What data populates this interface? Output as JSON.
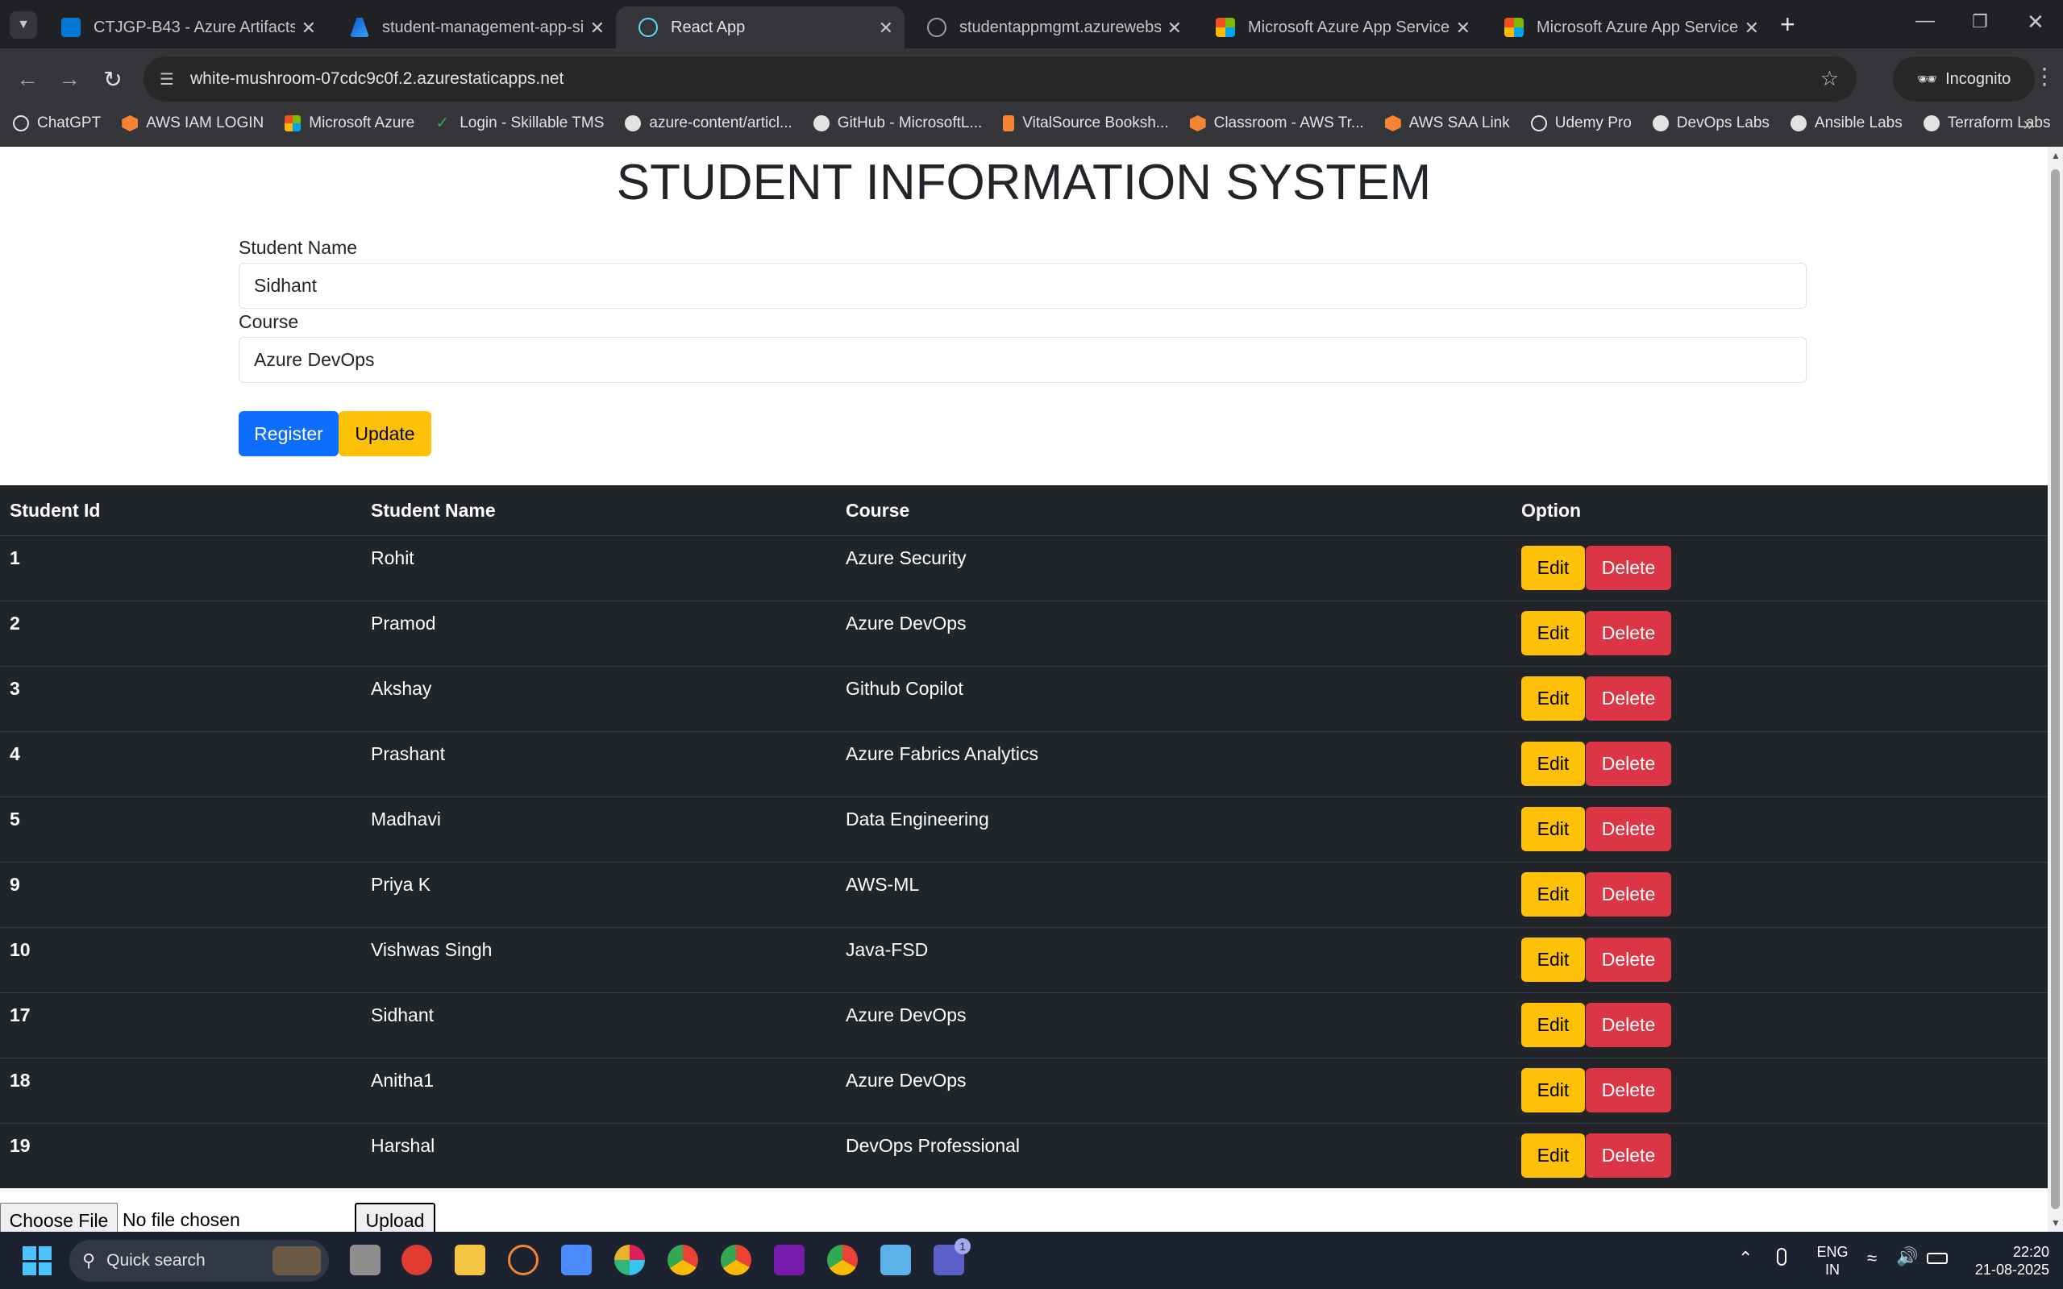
{
  "browser": {
    "tabs": [
      {
        "label": "CTJGP-B43 - Azure Artifacts",
        "favicon": "azure-devops-icon",
        "active": false
      },
      {
        "label": "student-management-app-sidh",
        "favicon": "azure-icon",
        "active": false
      },
      {
        "label": "React App",
        "favicon": "react-icon",
        "active": true
      },
      {
        "label": "studentappmgmt.azurewebsite",
        "favicon": "globe-icon",
        "active": false
      },
      {
        "label": "Microsoft Azure App Service - W",
        "favicon": "microsoft-icon",
        "active": false
      },
      {
        "label": "Microsoft Azure App Service - W",
        "favicon": "microsoft-icon",
        "active": false
      }
    ],
    "url": "white-mushroom-07cdc9c0f.2.azurestaticapps.net",
    "incognito_label": "Incognito",
    "bookmarks": [
      "ChatGPT",
      "AWS IAM LOGIN",
      "Microsoft Azure",
      "Login - Skillable TMS",
      "azure-content/articl...",
      "GitHub - MicrosoftL...",
      "VitalSource Booksh...",
      "Classroom - AWS Tr...",
      "AWS SAA Link",
      "Udemy Pro",
      "DevOps Labs",
      "Ansible Labs",
      "Terraform Labs"
    ]
  },
  "app": {
    "title": "STUDENT INFORMATION SYSTEM",
    "form": {
      "name_label": "Student Name",
      "name_value": "Sidhant",
      "course_label": "Course",
      "course_value": "Azure DevOps",
      "register_label": "Register",
      "update_label": "Update"
    },
    "table": {
      "headers": [
        "Student Id",
        "Student Name",
        "Course",
        "Option"
      ],
      "edit_label": "Edit",
      "delete_label": "Delete",
      "rows": [
        {
          "id": "1",
          "name": "Rohit",
          "course": "Azure Security"
        },
        {
          "id": "2",
          "name": "Pramod",
          "course": "Azure DevOps"
        },
        {
          "id": "3",
          "name": "Akshay",
          "course": "Github Copilot"
        },
        {
          "id": "4",
          "name": "Prashant",
          "course": "Azure Fabrics Analytics"
        },
        {
          "id": "5",
          "name": "Madhavi",
          "course": "Data Engineering"
        },
        {
          "id": "9",
          "name": "Priya K",
          "course": "AWS-ML"
        },
        {
          "id": "10",
          "name": "Vishwas Singh",
          "course": "Java-FSD"
        },
        {
          "id": "17",
          "name": "Sidhant",
          "course": "Azure DevOps"
        },
        {
          "id": "18",
          "name": "Anitha1",
          "course": "Azure DevOps"
        },
        {
          "id": "19",
          "name": "Harshal",
          "course": "DevOps Professional"
        }
      ]
    },
    "file": {
      "choose_label": "Choose File",
      "status": "No file chosen",
      "upload_label": "Upload"
    }
  },
  "taskbar": {
    "search_placeholder": "Quick search",
    "language_line1": "ENG",
    "language_line2": "IN",
    "time": "22:20",
    "date": "21-08-2025",
    "teams_badge": "1"
  },
  "colors": {
    "primary": "#0d6efd",
    "warning": "#ffc107",
    "danger": "#dc3545",
    "table_dark": "#212529"
  }
}
